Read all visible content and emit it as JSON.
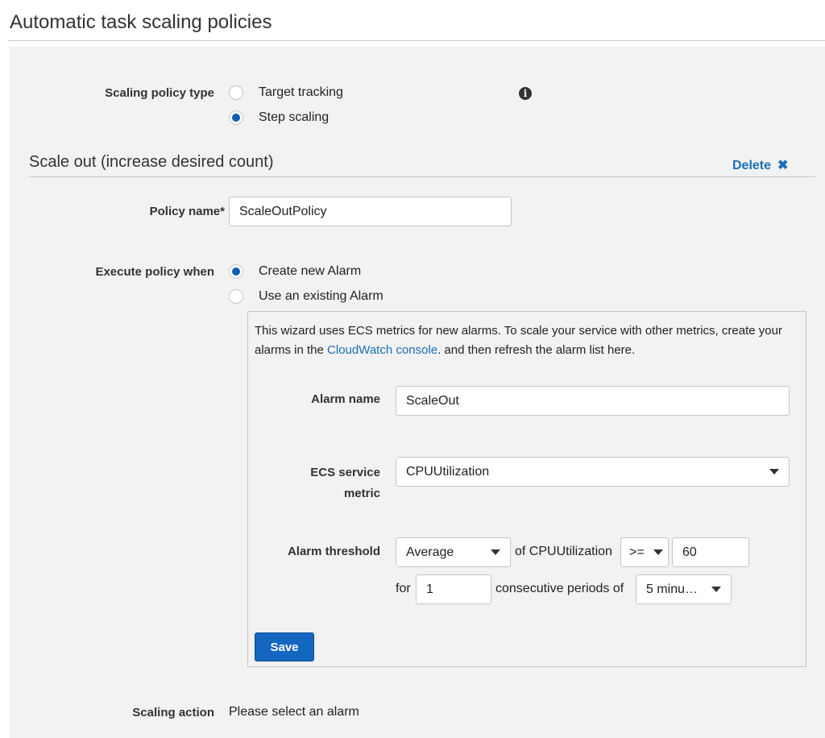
{
  "page": {
    "title": "Automatic task scaling policies"
  },
  "scaling_policy_type": {
    "label": "Scaling policy type",
    "options": [
      {
        "label": "Target tracking",
        "selected": false
      },
      {
        "label": "Step scaling",
        "selected": true
      }
    ],
    "info_icon": "info-icon",
    "info_glyph": "i"
  },
  "scale_out": {
    "section_title": "Scale out (increase desired count)",
    "delete_label": "Delete",
    "delete_glyph": "✖",
    "policy_name": {
      "label": "Policy name*",
      "value": "ScaleOutPolicy"
    },
    "execute_when": {
      "label": "Execute policy when",
      "options": [
        {
          "label": "Create new Alarm",
          "selected": true
        },
        {
          "label": "Use an existing Alarm",
          "selected": false
        }
      ]
    },
    "wizard": {
      "note_before_link": "This wizard uses ECS metrics for new alarms. To scale your service with other metrics, create your alarms in the ",
      "link_text": "CloudWatch console",
      "note_after_link": ". and then refresh the alarm list here.",
      "alarm_name": {
        "label": "Alarm name",
        "value": "ScaleOut"
      },
      "metric": {
        "label_line1": "ECS service",
        "label_line2": "metric",
        "value": "CPUUtilization"
      },
      "threshold": {
        "label": "Alarm threshold",
        "statistic": "Average",
        "of_text": "of CPUUtilization",
        "operator": ">=",
        "value": "60",
        "for_text": "for",
        "periods": "1",
        "consecutive_text": "consecutive periods of",
        "period_length": "5 minu…"
      },
      "save_label": "Save"
    }
  },
  "scaling_action": {
    "label": "Scaling action",
    "value": "Please select an alarm"
  },
  "colors": {
    "accent": "#1467c0",
    "link": "#1a6fb8",
    "panel": "#f2f2f2"
  }
}
